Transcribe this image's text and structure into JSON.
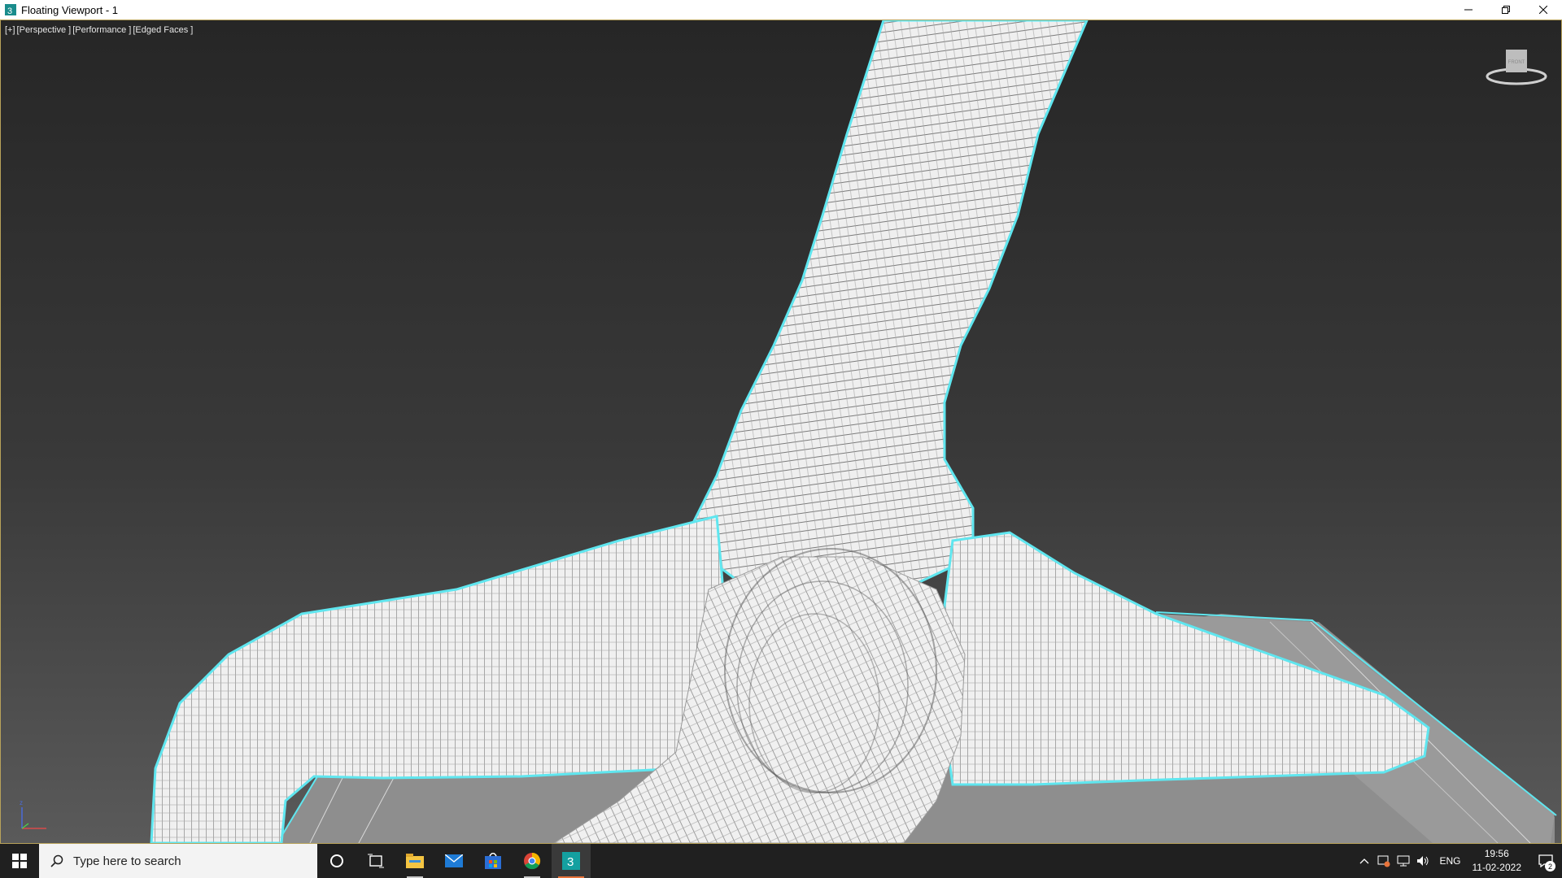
{
  "window": {
    "title": "Floating Viewport - 1",
    "icon": "3ds-max-icon",
    "controls": [
      "minimize-icon",
      "restore-icon",
      "close-icon"
    ]
  },
  "viewport": {
    "labels": [
      "[+]",
      "[Perspective ]",
      "[Performance ]",
      "[Edged Faces ]"
    ],
    "viewcube_label": "FRONT",
    "axis": {
      "x": "x",
      "y": "y",
      "z": "z"
    },
    "colors": {
      "selection_outline": "#5fe6ef",
      "mesh": "#f2f2f2",
      "wire": "#7a7a7a",
      "ground": "#8a8a8a"
    }
  },
  "taskbar": {
    "start_icon": "windows-icon",
    "search_placeholder": "Type here to search",
    "pinned": [
      {
        "name": "cortana-icon"
      },
      {
        "name": "task-view-icon"
      },
      {
        "name": "file-explorer-icon"
      },
      {
        "name": "mail-icon"
      },
      {
        "name": "microsoft-store-icon"
      },
      {
        "name": "chrome-icon"
      },
      {
        "name": "3ds-max-icon"
      }
    ],
    "tray": {
      "language": "ENG",
      "time": "19:56",
      "date": "11-02-2022",
      "notifications": "2"
    }
  }
}
